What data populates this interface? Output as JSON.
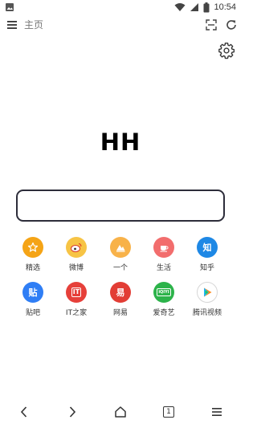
{
  "status_bar": {
    "time": "10:54",
    "icons": [
      "image-icon",
      "wifi-icon",
      "signal-icon",
      "battery-icon"
    ]
  },
  "toolbar": {
    "address_text": "主页",
    "icons": [
      "menu-icon",
      "scan-icon",
      "refresh-icon"
    ]
  },
  "settings": {
    "icon": "gear-icon"
  },
  "logo": {
    "text": "HH"
  },
  "search": {
    "value": "",
    "placeholder": ""
  },
  "shortcuts": [
    {
      "label": "精选",
      "icon": "star-icon",
      "color": "#f5a416"
    },
    {
      "label": "微博",
      "icon": "weibo-icon",
      "color": "#f7c445"
    },
    {
      "label": "一个",
      "icon": "mountain-icon",
      "color": "#f8b249"
    },
    {
      "label": "生活",
      "icon": "cup-icon",
      "color": "#f26d6d"
    },
    {
      "label": "知乎",
      "icon": "zhihu-icon",
      "color": "#1e88e5",
      "glyph": "知"
    },
    {
      "label": "贴吧",
      "icon": "tieba-icon",
      "color": "#2f7ef5",
      "glyph": "贴"
    },
    {
      "label": "IT之家",
      "icon": "ithome-icon",
      "color": "#e6403a",
      "glyph": "IT"
    },
    {
      "label": "网易",
      "icon": "netease-icon",
      "color": "#e23d35",
      "glyph": "易"
    },
    {
      "label": "爱奇艺",
      "icon": "iqiyi-icon",
      "color": "#2cb34a",
      "glyph": "iQIYI"
    },
    {
      "label": "腾讯视频",
      "icon": "tencent-video-icon",
      "color": "#ffffff"
    }
  ],
  "bottom_nav": {
    "tab_count": "1",
    "icons": [
      "back-icon",
      "forward-icon",
      "home-icon",
      "tabs-icon",
      "menu-icon"
    ]
  }
}
